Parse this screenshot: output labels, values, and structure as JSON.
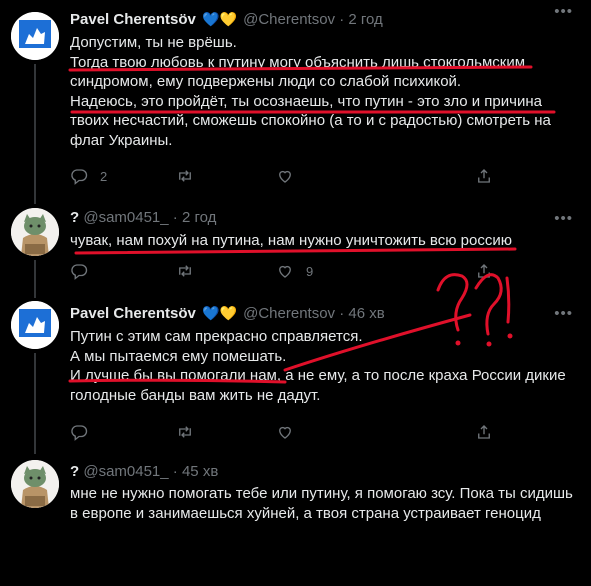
{
  "tweets": [
    {
      "author": "Pavel Cherentsöv",
      "hearts": "💙💛",
      "handle": "@Cherentsov",
      "dot": "·",
      "time": "2 год",
      "lines": [
        "Допустим, ты не врёшь.",
        "Тогда твою любовь к путину могу объяснить лишь стокгольмским синдромом, ему подвержены люди со слабой психикой.",
        "Надеюсь, это пройдёт, ты осознаешь, что путин - это зло и причина твоих несчастий, сможешь спокойно (а то и с радостью) смотреть на флаг Украины."
      ],
      "reply_count": "2",
      "retweet_count": "",
      "like_count": ""
    },
    {
      "author": "?",
      "handle": "@sam0451_",
      "dot": "·",
      "time": "2 год",
      "lines": [
        "чувак, нам похуй на путина, нам нужно уничтожить всю россию"
      ],
      "reply_count": "",
      "retweet_count": "",
      "like_count": "9"
    },
    {
      "author": "Pavel Cherentsöv",
      "hearts": "💙💛",
      "handle": "@Cherentsov",
      "dot": "·",
      "time": "46 хв",
      "lines": [
        "Путин с этим сам прекрасно справляется.",
        "А мы пытаемся ему помешать.",
        "И лучше бы вы помогали нам, а не ему, а то после краха России дикие голодные банды вам жить не дадут."
      ],
      "reply_count": "",
      "retweet_count": "",
      "like_count": ""
    },
    {
      "author": "?",
      "handle": "@sam0451_",
      "dot": "·",
      "time": "45 хв",
      "lines": [
        "мне не нужно помогать тебе или путину, я помогаю зсу. Пока ты сидишь в европе и занимаешься хуйней, а твоя страна устраивает геноцид"
      ],
      "reply_count": "",
      "retweet_count": "",
      "like_count": ""
    }
  ],
  "colors": {
    "background": "#000000",
    "text": "#e7e9ea",
    "muted": "#71767b",
    "annotation": "#e0102a",
    "logo_blue": "#1d6fd6"
  },
  "icons": [
    "more-icon",
    "reply-icon",
    "retweet-icon",
    "like-icon",
    "share-icon"
  ]
}
